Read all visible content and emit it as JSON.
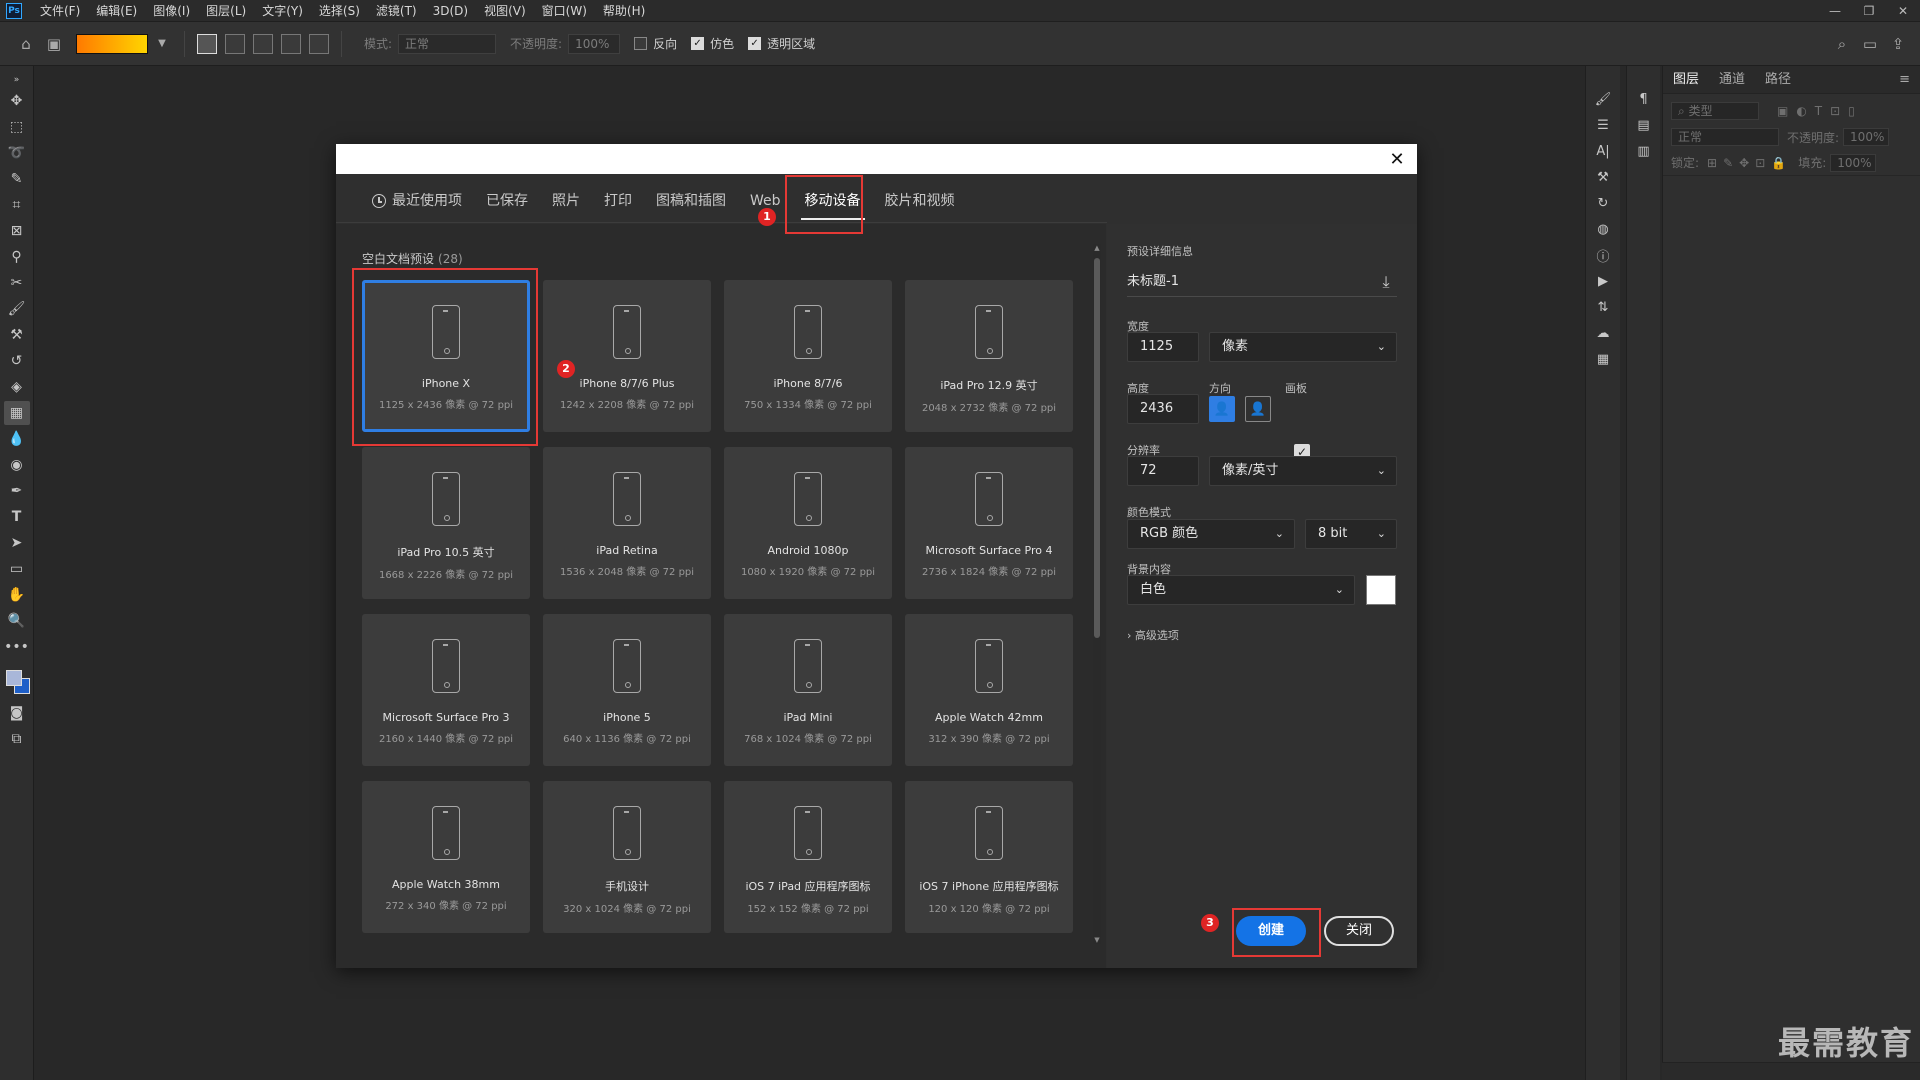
{
  "menubar": {
    "logo": "Ps",
    "items": [
      "文件(F)",
      "编辑(E)",
      "图像(I)",
      "图层(L)",
      "文字(Y)",
      "选择(S)",
      "滤镜(T)",
      "3D(D)",
      "视图(V)",
      "窗口(W)",
      "帮助(H)"
    ]
  },
  "options": {
    "mode_label": "模式:",
    "mode_value": "正常",
    "opacity_label": "不透明度:",
    "opacity_value": "100%",
    "reverse_label": "反向",
    "dither_label": "仿色",
    "transparency_label": "透明区域"
  },
  "dialog": {
    "tabs": [
      "最近使用项",
      "已保存",
      "照片",
      "打印",
      "图稿和插图",
      "Web",
      "移动设备",
      "胶片和视频"
    ],
    "active_tab": "移动设备",
    "presets_title": "空白文档预设",
    "presets_count": "(28)",
    "presets": [
      {
        "name": "iPhone X",
        "spec": "1125 x 2436 像素 @ 72 ppi"
      },
      {
        "name": "iPhone 8/7/6 Plus",
        "spec": "1242 x 2208 像素 @ 72 ppi"
      },
      {
        "name": "iPhone 8/7/6",
        "spec": "750 x 1334 像素 @ 72 ppi"
      },
      {
        "name": "iPad Pro 12.9 英寸",
        "spec": "2048 x 2732 像素 @ 72 ppi"
      },
      {
        "name": "iPad Pro 10.5 英寸",
        "spec": "1668 x 2226 像素 @ 72 ppi"
      },
      {
        "name": "iPad Retina",
        "spec": "1536 x 2048 像素 @ 72 ppi"
      },
      {
        "name": "Android 1080p",
        "spec": "1080 x 1920 像素 @ 72 ppi"
      },
      {
        "name": "Microsoft Surface Pro 4",
        "spec": "2736 x 1824 像素 @ 72 ppi"
      },
      {
        "name": "Microsoft Surface Pro 3",
        "spec": "2160 x 1440 像素 @ 72 ppi"
      },
      {
        "name": "iPhone 5",
        "spec": "640 x 1136 像素 @ 72 ppi"
      },
      {
        "name": "iPad Mini",
        "spec": "768 x 1024 像素 @ 72 ppi"
      },
      {
        "name": "Apple Watch 42mm",
        "spec": "312 x 390 像素 @ 72 ppi"
      },
      {
        "name": "Apple Watch 38mm",
        "spec": "272 x 340 像素 @ 72 ppi"
      },
      {
        "name": "手机设计",
        "spec": "320 x 1024 像素 @ 72 ppi"
      },
      {
        "name": "iOS 7 iPad 应用程序图标",
        "spec": "152 x 152 像素 @ 72 ppi"
      },
      {
        "name": "iOS 7 iPhone 应用程序图标",
        "spec": "120 x 120 像素 @ 72 ppi"
      }
    ],
    "details": {
      "header": "预设详细信息",
      "doc_name": "未标题-1",
      "width_label": "宽度",
      "width_value": "1125",
      "width_unit": "像素",
      "height_label": "高度",
      "height_value": "2436",
      "orientation_label": "方向",
      "artboard_label": "画板",
      "resolution_label": "分辨率",
      "resolution_value": "72",
      "resolution_unit": "像素/英寸",
      "color_mode_label": "颜色模式",
      "color_mode_value": "RGB 颜色",
      "bit_depth_value": "8 bit",
      "bg_label": "背景内容",
      "bg_value": "白色",
      "advanced_label": "高级选项"
    },
    "create_label": "创建",
    "close_label": "关闭"
  },
  "layers_panel": {
    "tabs": [
      "图层",
      "通道",
      "路径"
    ],
    "filter_placeholder": "类型",
    "blend_value": "正常",
    "opacity_label": "不透明度:",
    "opacity_value": "100%",
    "lock_label": "锁定:",
    "fill_label": "填充:",
    "fill_value": "100%"
  },
  "annotations": [
    "1",
    "2",
    "3"
  ],
  "watermark": "最需教育"
}
